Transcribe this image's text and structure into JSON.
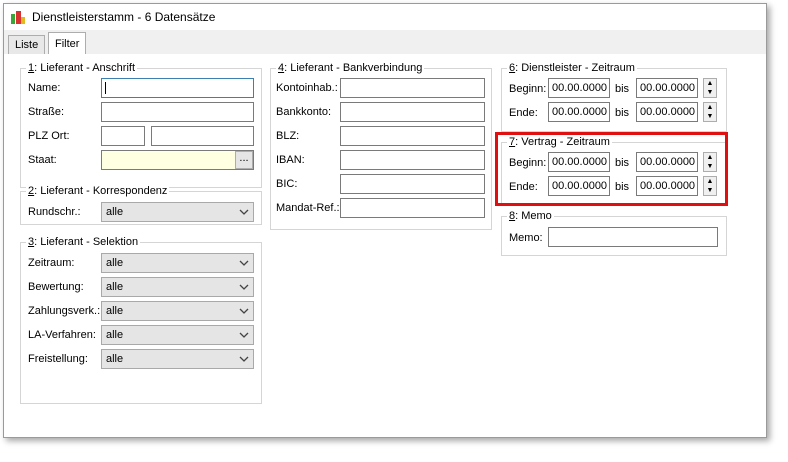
{
  "window": {
    "title": "Dienstleisterstamm - 6 Datensätze"
  },
  "tabs": [
    {
      "label": "Liste"
    },
    {
      "label": "Filter"
    }
  ],
  "group1": {
    "num": "1",
    "title": ": Lieferant - Anschrift",
    "name_label": "Name:",
    "strasse_label": "Straße:",
    "plz_label": "PLZ Ort:",
    "staat_label": "Staat:",
    "dots": "..."
  },
  "group2": {
    "num": "2",
    "title": ": Lieferant - Korrespondenz",
    "rundschr_label": "Rundschr.:",
    "rundschr_value": "alle"
  },
  "group3": {
    "num": "3",
    "title": ": Lieferant - Selektion",
    "rows": [
      {
        "label": "Zeitraum:",
        "value": "alle"
      },
      {
        "label": "Bewertung:",
        "value": "alle"
      },
      {
        "label": "Zahlungsverk.:",
        "value": "alle"
      },
      {
        "label": "LA-Verfahren:",
        "value": "alle"
      },
      {
        "label": "Freistellung:",
        "value": "alle"
      }
    ]
  },
  "group4": {
    "num": "4",
    "title": ": Lieferant - Bankverbindung",
    "labels": [
      "Kontoinhab.:",
      "Bankkonto:",
      "BLZ:",
      "IBAN:",
      "BIC:",
      "Mandat-Ref.:"
    ]
  },
  "group6": {
    "num": "6",
    "title": ": Dienstleister - Zeitraum",
    "beginn_label": "Beginn:",
    "ende_label": "Ende:",
    "bis": "bis",
    "beginn_from": "00.00.0000",
    "beginn_to": "00.00.0000",
    "ende_from": "00.00.0000",
    "ende_to": "00.00.0000"
  },
  "group7": {
    "num": "7",
    "title": ": Vertrag - Zeitraum",
    "beginn_label": "Beginn:",
    "ende_label": "Ende:",
    "bis": "bis",
    "beginn_from": "00.00.0000",
    "beginn_to": "00.00.0000",
    "ende_from": "00.00.0000",
    "ende_to": "00.00.0000"
  },
  "group8": {
    "num": "8",
    "title": ": Memo",
    "memo_label": "Memo:"
  },
  "colors": {
    "highlight": "#e01010",
    "staat_field": "#ffffe1"
  }
}
